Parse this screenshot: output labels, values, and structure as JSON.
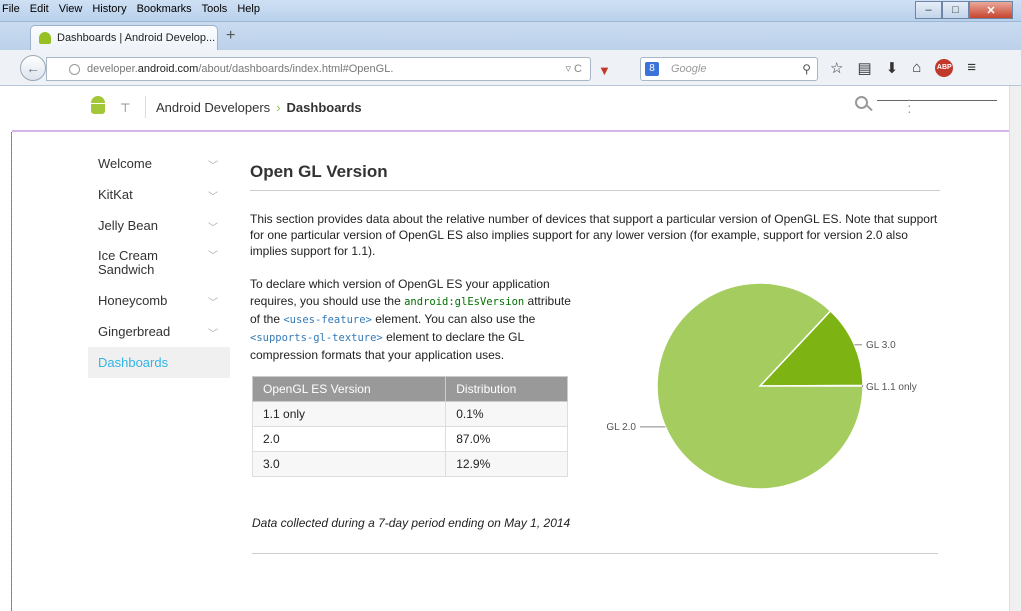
{
  "menu": {
    "file": "File",
    "edit": "Edit",
    "view": "View",
    "history": "History",
    "bookmarks": "Bookmarks",
    "tools": "Tools",
    "help": "Help"
  },
  "tab": {
    "title": "Dashboards | Android Develop...",
    "new_tab": "+"
  },
  "url": {
    "prefix": "developer.",
    "domain": "android.com",
    "path": "/about/dashboards/index.html#OpenGL."
  },
  "search": {
    "engine_badge": "8",
    "placeholder": "Google"
  },
  "toolbar": {
    "abp_label": "ABP"
  },
  "header": {
    "breadcrumb_root": "Android Developers",
    "breadcrumb_sep": "›",
    "breadcrumb_current": "Dashboards"
  },
  "sidenav": {
    "items": [
      {
        "label": "Welcome"
      },
      {
        "label": "KitKat"
      },
      {
        "label": "Jelly Bean"
      },
      {
        "label": "Ice Cream Sandwich"
      },
      {
        "label": "Honeycomb"
      },
      {
        "label": "Gingerbread"
      },
      {
        "label": "Dashboards"
      }
    ]
  },
  "content": {
    "title": "Open GL Version",
    "description": "This section provides data about the relative number of devices that support a particular version of OpenGL ES. Note that support for one particular version of OpenGL ES also implies support for any lower version (for example, support for version 2.0 also implies support for 1.1).",
    "declare_1": "To declare which version of OpenGL ES your application requires, you should use the ",
    "declare_code_1": "android:glEsVersion",
    "declare_2": " attribute of the ",
    "declare_code_2": "<uses-feature>",
    "declare_3": " element. You can also use the ",
    "declare_code_3": "<supports-gl-texture>",
    "declare_4": " element to declare the GL compression formats that your application uses.",
    "table_headers": [
      "OpenGL ES Version",
      "Distribution"
    ],
    "table_rows": [
      [
        "1.1 only",
        "0.1%"
      ],
      [
        "2.0",
        "87.0%"
      ],
      [
        "3.0",
        "12.9%"
      ]
    ],
    "footnote": "Data collected during a 7-day period ending on May 1, 2014"
  },
  "chart_data": {
    "type": "pie",
    "labels": [
      "GL 2.0",
      "GL 3.0",
      "GL 1.1 only"
    ],
    "values": [
      87.0,
      12.9,
      0.1
    ],
    "colors": [
      "#a4cc5e",
      "#7db312",
      "#5a8a0a"
    ]
  }
}
